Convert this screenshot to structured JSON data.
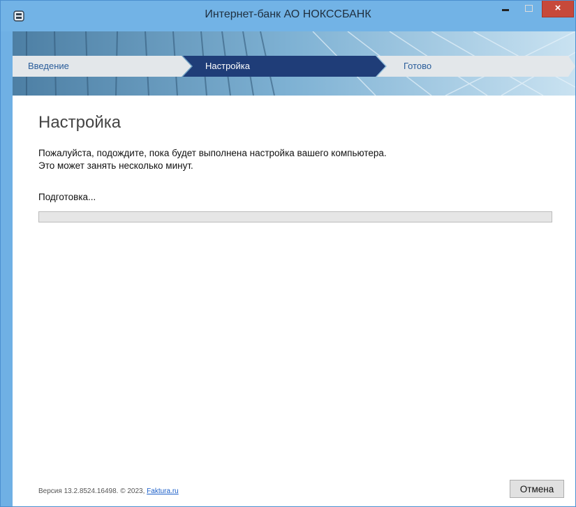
{
  "window": {
    "title": "Интернет-банк АО НОКССБАНК",
    "icon": "bank-app-icon",
    "controls": {
      "minimize": "minimize-icon",
      "maximize": "maximize-icon",
      "close": "×"
    }
  },
  "steps": [
    {
      "label": "Введение",
      "state": "done"
    },
    {
      "label": "Настройка",
      "state": "active"
    },
    {
      "label": "Готово",
      "state": "pending"
    }
  ],
  "main": {
    "title": "Настройка",
    "description_line1": "Пожалуйста, подождите, пока будет выполнена настройка вашего компьютера.",
    "description_line2": "Это может занять несколько минут.",
    "status": "Подготовка...",
    "progress": 0
  },
  "footer": {
    "version_text": "Версия 13.2.8524.16498. © 2023, ",
    "link_text": "Faktura.ru",
    "cancel_label": "Отмена"
  },
  "colors": {
    "titlebar": "#72b3e6",
    "active_step": "#1f3d78",
    "step_text": "#2a5d9a",
    "close_button": "#c7493a",
    "link": "#1a5ec8"
  }
}
